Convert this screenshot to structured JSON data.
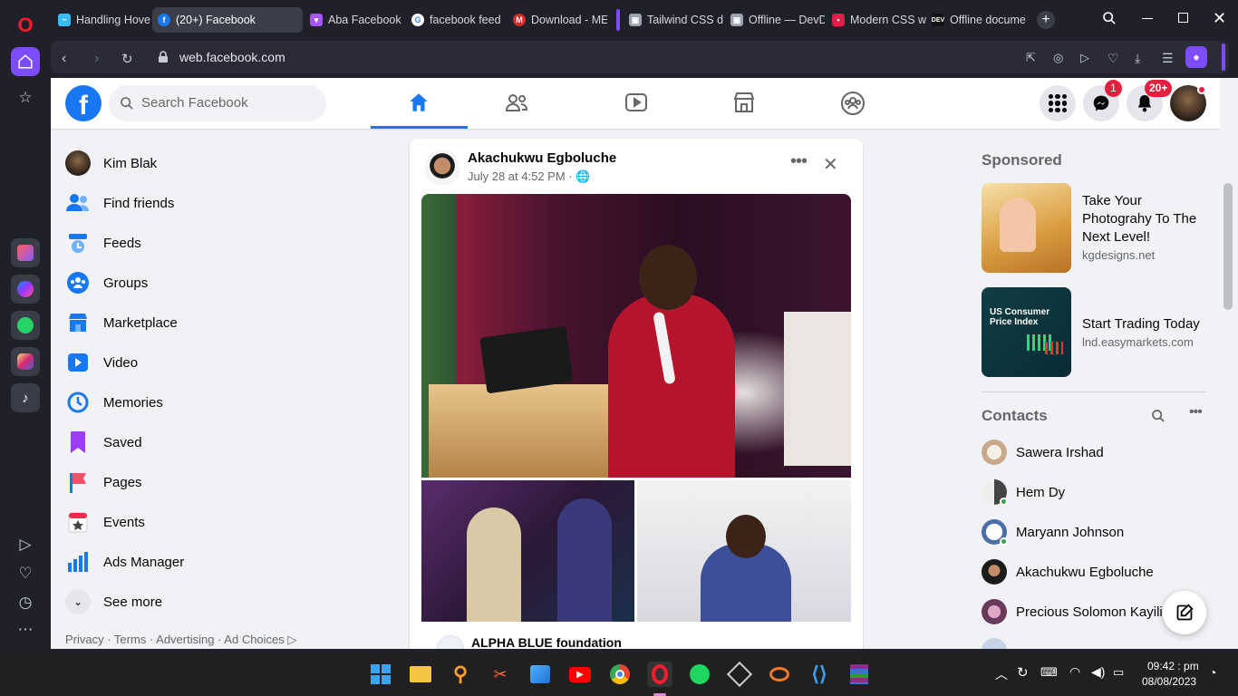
{
  "browser": {
    "tabs": [
      {
        "title": "Handling Hover",
        "color": "#38bdf8"
      },
      {
        "title": "(20+) Facebook",
        "color": "#1877f2"
      },
      {
        "title": "Aba Facebook",
        "color": "#facc15"
      },
      {
        "title": "facebook feed",
        "color": "#4285f4"
      },
      {
        "title": "Download - ME",
        "color": "#d62b2b"
      },
      {
        "title": "Tailwind CSS do",
        "color": "#38bdf8"
      },
      {
        "title": "Offline — DevD",
        "color": "#e5e7eb"
      },
      {
        "title": "Modern CSS wi",
        "color": "#e11d48"
      },
      {
        "title": "Offline docume",
        "color": "#111111"
      }
    ],
    "url": "web.facebook.com"
  },
  "facebook": {
    "search_placeholder": "Search Facebook",
    "badges": {
      "messenger": "1",
      "notifications": "20+"
    },
    "left_nav": [
      {
        "label": "Kim Blak",
        "icon": "avatar"
      },
      {
        "label": "Find friends",
        "icon": "friends-icon"
      },
      {
        "label": "Feeds",
        "icon": "feeds-icon"
      },
      {
        "label": "Groups",
        "icon": "groups-icon"
      },
      {
        "label": "Marketplace",
        "icon": "marketplace-icon"
      },
      {
        "label": "Video",
        "icon": "video-icon"
      },
      {
        "label": "Memories",
        "icon": "memories-icon"
      },
      {
        "label": "Saved",
        "icon": "saved-icon"
      },
      {
        "label": "Pages",
        "icon": "pages-icon"
      },
      {
        "label": "Events",
        "icon": "events-icon"
      },
      {
        "label": "Ads Manager",
        "icon": "ads-manager-icon"
      },
      {
        "label": "See more",
        "icon": "chevron-down-icon"
      }
    ],
    "footer_links": "Privacy · Terms · Advertising · Ad Choices",
    "post": {
      "author": "Akachukwu Egboluche",
      "date": "July 28 at 4:52 PM ·",
      "shared_page": "ALPHA BLUE foundation"
    },
    "sponsored": {
      "heading": "Sponsored",
      "ads": [
        {
          "title": "Take Your Photograhy To The Next Level!",
          "domain": "kgdesigns.net"
        },
        {
          "title": "Start Trading Today",
          "domain": "lnd.easymarkets.com",
          "image_text": "US Consumer Price Index"
        }
      ]
    },
    "contacts": {
      "heading": "Contacts",
      "list": [
        {
          "name": "Sawera Irshad",
          "online": false
        },
        {
          "name": "Hem Dy",
          "online": true
        },
        {
          "name": "Maryann Johnson",
          "online": true
        },
        {
          "name": "Akachukwu Egboluche",
          "online": false
        },
        {
          "name": "Precious Solomon Kayili",
          "online": false
        }
      ]
    }
  },
  "taskbar": {
    "time": "09:42 : pm",
    "date": "08/08/2023"
  },
  "colors": {
    "fb_blue": "#1877f2",
    "notif_red": "#e41e3f",
    "opera_red": "#ff1b2d"
  }
}
